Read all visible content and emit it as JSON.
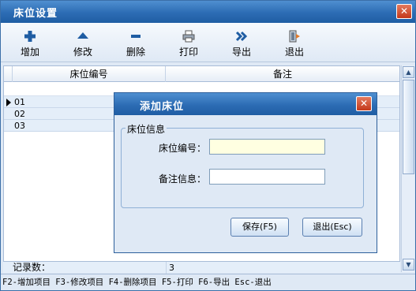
{
  "window": {
    "title": "床位设置",
    "close_glyph": "✕"
  },
  "toolbar": {
    "add": {
      "label": "增加",
      "icon": "plus-icon"
    },
    "edit": {
      "label": "修改",
      "icon": "triangle-up-icon"
    },
    "delete": {
      "label": "删除",
      "icon": "minus-icon"
    },
    "print": {
      "label": "打印",
      "icon": "printer-icon"
    },
    "export": {
      "label": "导出",
      "icon": "double-chevron-right-icon"
    },
    "exit": {
      "label": "退出",
      "icon": "door-exit-icon"
    }
  },
  "grid": {
    "columns": [
      "床位编号",
      "备注"
    ],
    "rows": [
      {
        "bed_no": "01",
        "note": ""
      },
      {
        "bed_no": "02",
        "note": ""
      },
      {
        "bed_no": "03",
        "note": ""
      }
    ],
    "footer_label": "记录数：",
    "footer_value": "3"
  },
  "statusbar": "F2-增加项目 F3-修改项目 F4-删除项目 F5-打印 F6-导出 Esc-退出",
  "dialog": {
    "title": "添加床位",
    "close_glyph": "✕",
    "group_title": "床位信息",
    "bed_no_label": "床位编号：",
    "bed_no_value": "",
    "note_label": "备注信息：",
    "note_value": "",
    "save_label": "保存(F5)",
    "exit_label": "退出(Esc)"
  },
  "colors": {
    "titlebar": "#2c6cb4",
    "background": "#dfe9f5",
    "input_highlight": "#ffffe1"
  }
}
